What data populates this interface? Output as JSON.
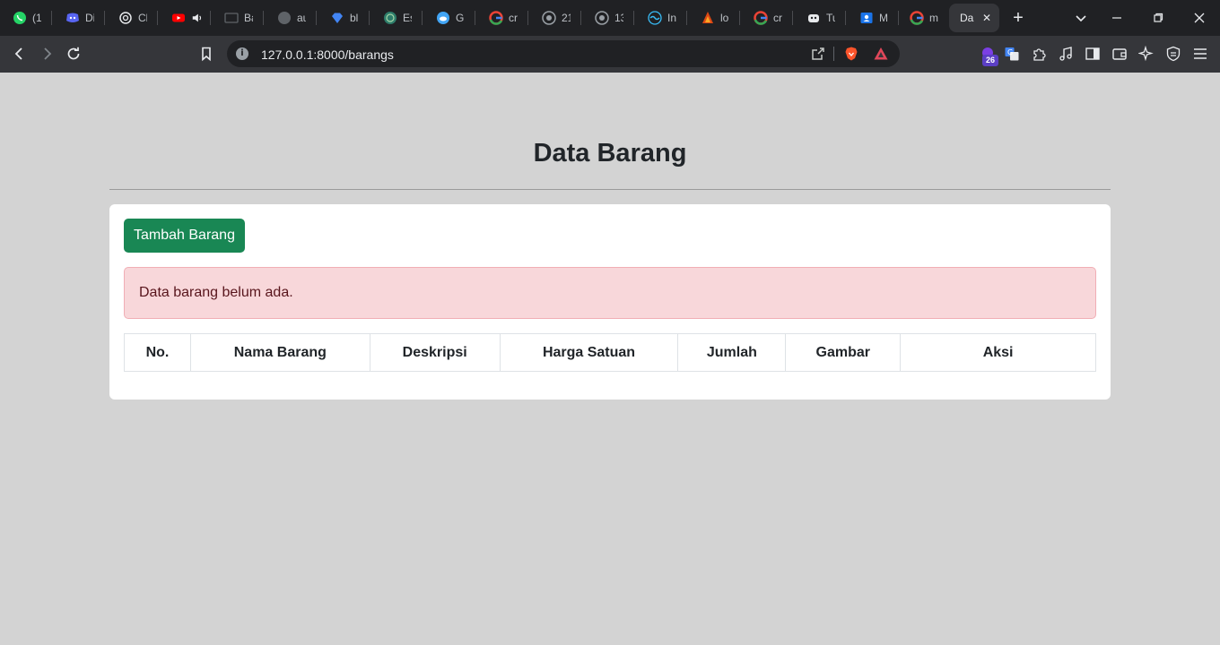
{
  "browser": {
    "tabs": [
      {
        "title": "(1",
        "icon": "whatsapp-icon",
        "color": "#25d366"
      },
      {
        "title": "Di",
        "icon": "discord-icon",
        "color": "#5865f2"
      },
      {
        "title": "Cl",
        "icon": "openai-icon",
        "color": "#e8eaed"
      },
      {
        "title": "",
        "icon": "youtube-icon",
        "color": "#ff0000"
      },
      {
        "title": "Ba",
        "icon": "badge-icon",
        "color": "#5f6368"
      },
      {
        "title": "au",
        "icon": "github-icon",
        "color": "#5f6368"
      },
      {
        "title": "bl",
        "icon": "gem-icon",
        "color": "#4285f4"
      },
      {
        "title": "Es",
        "icon": "globe-icon",
        "color": "#2e7d6b"
      },
      {
        "title": "Gi",
        "icon": "circle-blue-icon",
        "color": "#42a5f5"
      },
      {
        "title": "cr",
        "icon": "google-icon",
        "color": "#4285f4"
      },
      {
        "title": "21",
        "icon": "chrome-gray-icon",
        "color": "#9aa0a6"
      },
      {
        "title": "13",
        "icon": "chrome-gray-icon",
        "color": "#9aa0a6"
      },
      {
        "title": "In",
        "icon": "tailwind-icon",
        "color": "#38bdf8"
      },
      {
        "title": "lo",
        "icon": "codeigniter-icon",
        "color": "#dd4814"
      },
      {
        "title": "cr",
        "icon": "google-icon",
        "color": "#4285f4"
      },
      {
        "title": "Tu",
        "icon": "robot-icon",
        "color": "#e8eaed"
      },
      {
        "title": "M",
        "icon": "contacts-icon",
        "color": "#1a73e8"
      },
      {
        "title": "m",
        "icon": "google-icon",
        "color": "#4285f4"
      }
    ],
    "active_tab": {
      "title": "Da",
      "close": "✕"
    },
    "new_tab": "+",
    "url": "127.0.0.1:8000/barangs",
    "extension_badge": "26"
  },
  "page": {
    "title": "Data Barang",
    "add_button": "Tambah Barang",
    "alert": "Data barang belum ada.",
    "columns": [
      "No.",
      "Nama Barang",
      "Deskripsi",
      "Harga Satuan",
      "Jumlah",
      "Gambar",
      "Aksi"
    ]
  },
  "colors": {
    "page_bg": "#d3d3d3",
    "primary_success": "#198754",
    "alert_bg": "#f8d7da",
    "alert_border": "#f1aeb5",
    "alert_text": "#58151c",
    "chrome_dark": "#202124",
    "chrome_toolbar": "#35363a"
  }
}
